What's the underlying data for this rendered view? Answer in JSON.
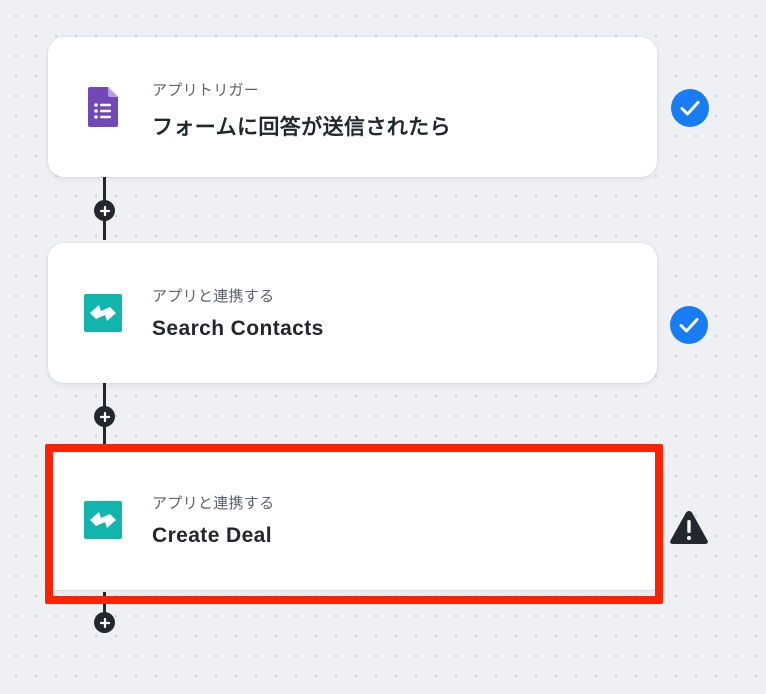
{
  "steps": [
    {
      "subtitle": "アプリトリガー",
      "title": "フォームに回答が送信されたら",
      "app_icon": "google-forms-icon",
      "status": "success"
    },
    {
      "subtitle": "アプリと連携する",
      "title": "Search Contacts",
      "app_icon": "app-tealbox-icon",
      "status": "success"
    },
    {
      "subtitle": "アプリと連携する",
      "title": "Create Deal",
      "app_icon": "app-tealbox-icon",
      "status": "warning"
    }
  ],
  "colors": {
    "forms_purple": "#7248b9",
    "app_teal": "#12b5ad",
    "success_blue": "#1a7cf2",
    "warning_dark": "#23272e",
    "highlight_red": "#ff2200"
  }
}
